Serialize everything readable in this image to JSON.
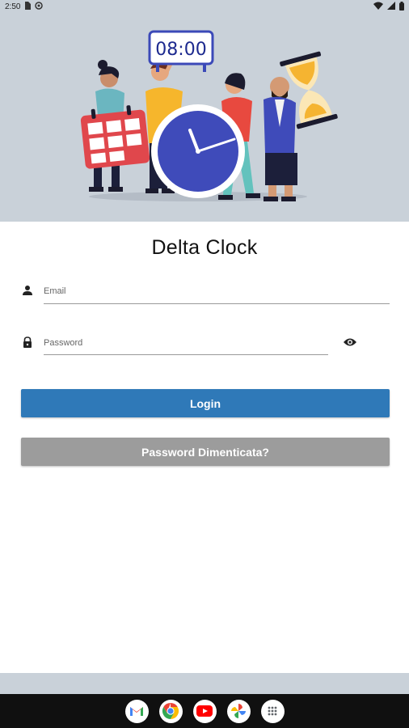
{
  "status_bar": {
    "time": "2:50",
    "icons": [
      "sim-card-icon",
      "settings-ring-icon",
      "wifi-icon",
      "signal-icon",
      "battery-icon"
    ]
  },
  "hero": {
    "clock_display": "08:00",
    "illustration": "people-holding-clock-calendar-hourglass"
  },
  "app": {
    "title": "Delta Clock"
  },
  "form": {
    "email": {
      "placeholder": "Email",
      "value": "",
      "icon": "person-icon"
    },
    "password": {
      "placeholder": "Password",
      "value": "",
      "icon": "lock-icon",
      "toggle_icon": "eye-icon"
    }
  },
  "buttons": {
    "login_label": "Login",
    "forgot_label": "Password Dimenticata?"
  },
  "colors": {
    "primary": "#2f79b8",
    "secondary": "#9c9c9c",
    "hero_bg": "#c9d1d9"
  },
  "dock": {
    "apps": [
      "gmail-icon",
      "chrome-icon",
      "youtube-icon",
      "photos-icon",
      "app-drawer-icon"
    ]
  }
}
